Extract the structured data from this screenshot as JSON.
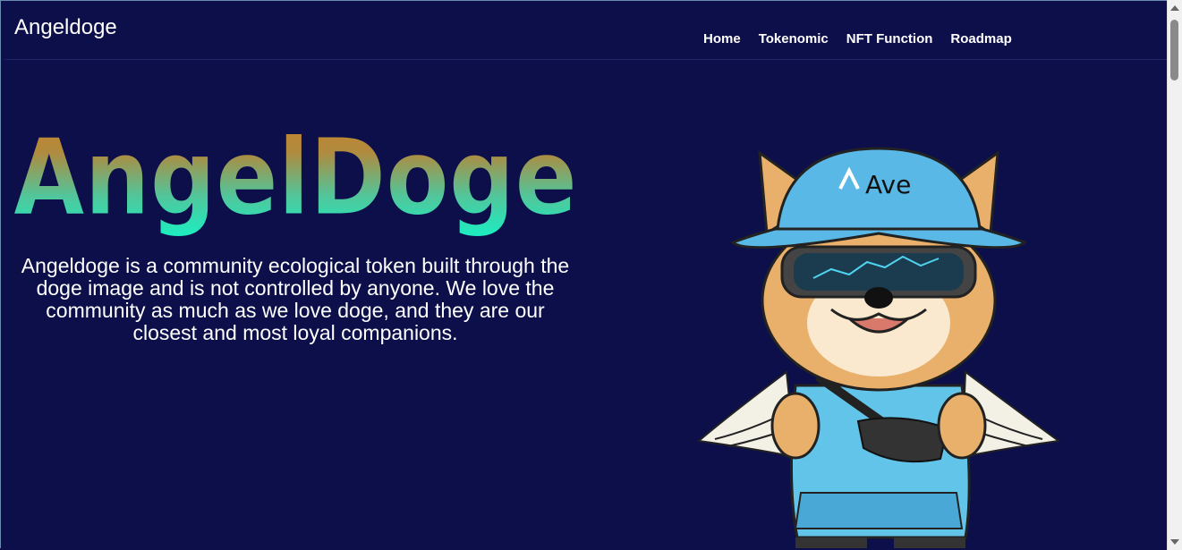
{
  "header": {
    "brand": "Angeldoge",
    "nav": [
      {
        "label": "Home"
      },
      {
        "label": "Tokenomic"
      },
      {
        "label": "NFT Function"
      },
      {
        "label": "Roadmap"
      }
    ]
  },
  "hero": {
    "title": "AngelDoge",
    "description": "Angeldoge is a community ecological token built through the doge image and is not controlled by anyone. We love the community as much as we love doge, and they are our closest and most loyal companions.",
    "hat_text": "Ave"
  },
  "colors": {
    "background": "#0d0f4a",
    "title_gradient_top": "#c8842a",
    "title_gradient_bottom": "#19f0c4",
    "hat_blue": "#5ab8e6"
  }
}
